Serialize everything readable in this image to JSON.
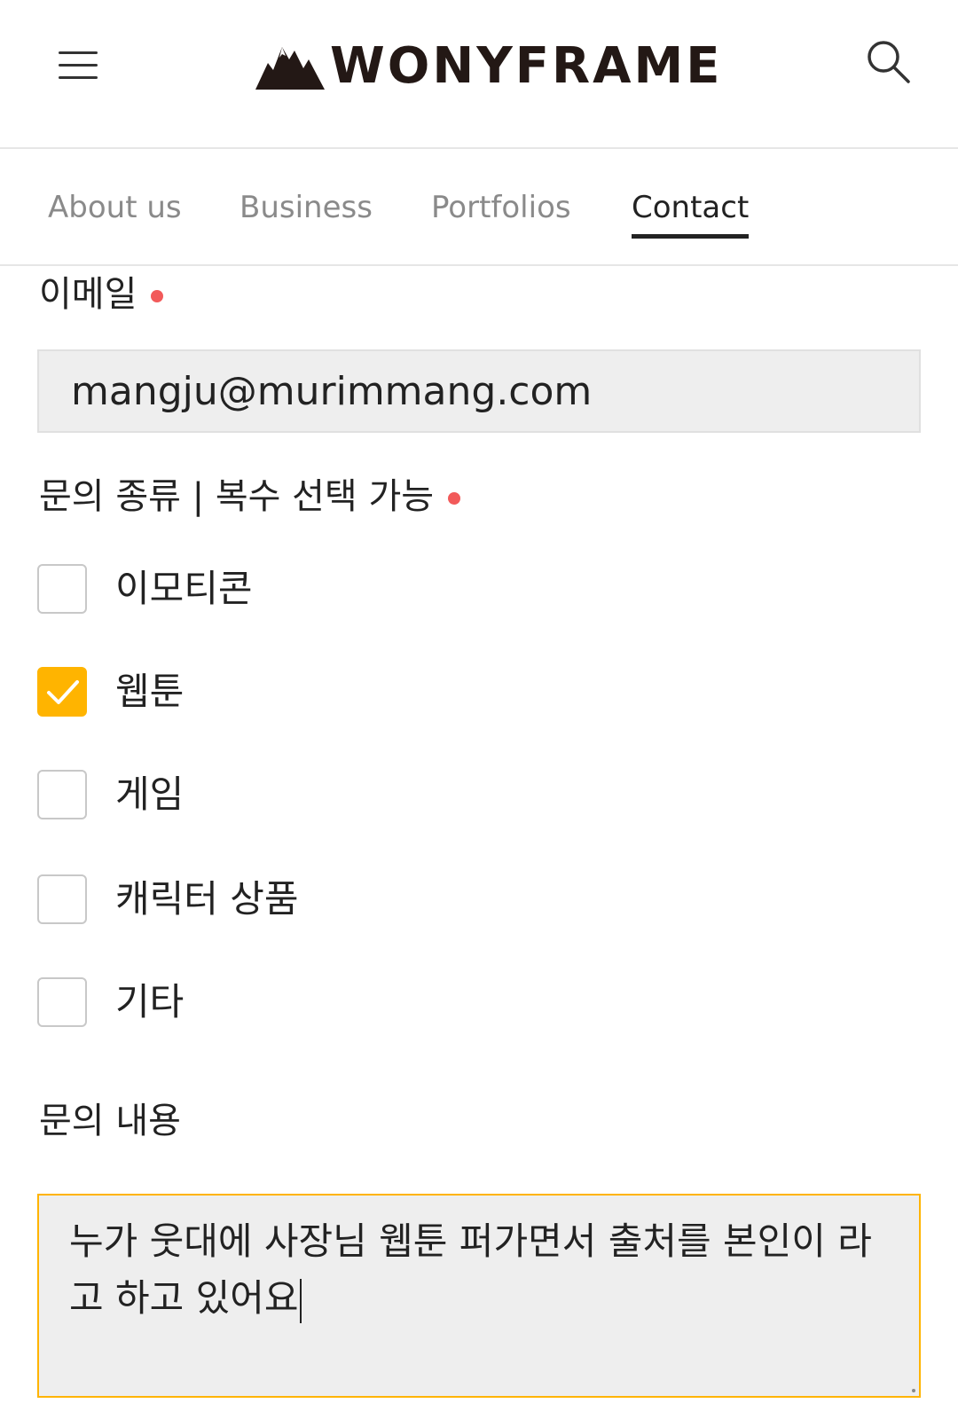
{
  "header": {
    "brand": "WONYFRAME",
    "menu_icon": "hamburger-menu-icon",
    "search_icon": "search-icon"
  },
  "tabs": [
    {
      "label": "About us",
      "active": false
    },
    {
      "label": "Business",
      "active": false
    },
    {
      "label": "Portfolios",
      "active": false
    },
    {
      "label": "Contact",
      "active": true
    }
  ],
  "form": {
    "email": {
      "label": "이메일",
      "required": true,
      "value": "mangju@murimmang.com"
    },
    "inquiry_type": {
      "label": "문의 종류 | 복수 선택 가능",
      "required": true,
      "options": [
        {
          "label": "이모티콘",
          "checked": false
        },
        {
          "label": "웹툰",
          "checked": true
        },
        {
          "label": "게임",
          "checked": false
        },
        {
          "label": "캐릭터 상품",
          "checked": false
        },
        {
          "label": "기타",
          "checked": false
        }
      ]
    },
    "content": {
      "label": "문의 내용",
      "value": "누가 웃대에 사장님 웹툰 퍼가면서 출처를 본인이 라고 하고 있어요"
    }
  },
  "colors": {
    "accent": "#ffb400",
    "required_dot": "#f25a5a",
    "text": "#222222",
    "muted": "#8a8a8a",
    "input_bg": "#eeeeee"
  }
}
